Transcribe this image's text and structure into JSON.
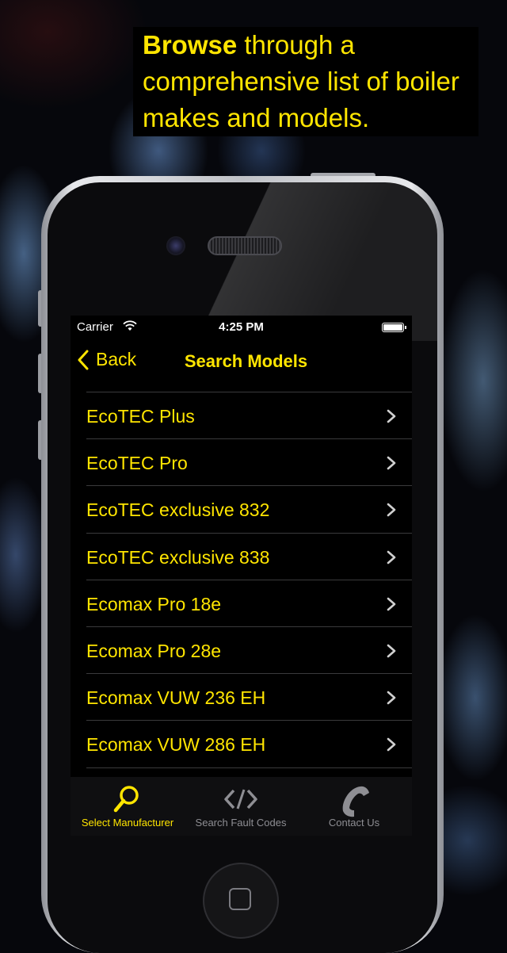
{
  "caption": {
    "bold": "Browse",
    "line1_rest": " through a",
    "line2": "comprehensive list of boiler",
    "line3": "makes and models."
  },
  "status_bar": {
    "carrier": "Carrier",
    "time": "4:25 PM",
    "battery_level": 1.0,
    "wifi_icon": "wifi-icon"
  },
  "navbar": {
    "back_label": "Back",
    "title": "Search Models",
    "back_icon": "chevron-left-icon"
  },
  "models": [
    "EcoTEC Plus",
    "EcoTEC Pro",
    "EcoTEC exclusive 832",
    "EcoTEC exclusive 838",
    "Ecomax Pro 18e",
    "Ecomax Pro 28e",
    "Ecomax VUW 236 EH",
    "Ecomax VUW 286 EH",
    ""
  ],
  "tabbar": {
    "tabs": [
      {
        "label": "Select Manufacturer",
        "icon": "search-icon",
        "active": true
      },
      {
        "label": "Search Fault Codes",
        "icon": "code-icon",
        "active": false
      },
      {
        "label": "Contact Us",
        "icon": "phone-icon",
        "active": false
      }
    ]
  },
  "colors": {
    "accent": "#ffe500",
    "inactive": "#8e8e93",
    "background": "#000000"
  }
}
